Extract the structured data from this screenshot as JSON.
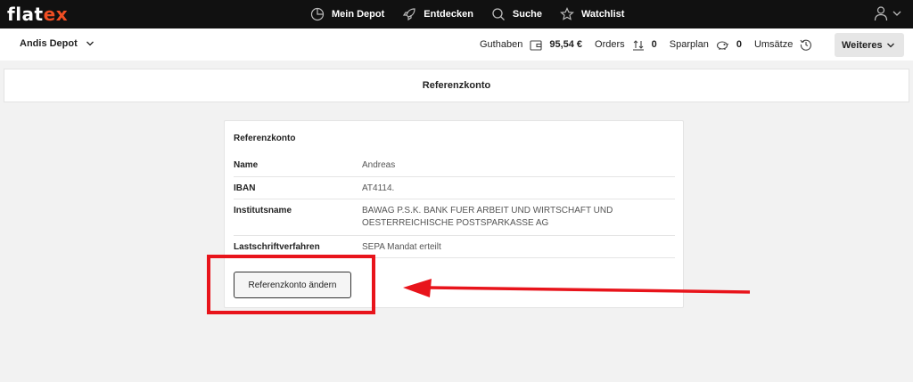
{
  "brand": {
    "logo_left": "flat",
    "logo_right": "ex",
    "accent": "#f04e23"
  },
  "topnav": [
    {
      "label": "Mein Depot",
      "icon": "pie-chart-icon"
    },
    {
      "label": "Entdecken",
      "icon": "rocket-icon"
    },
    {
      "label": "Suche",
      "icon": "search-icon"
    },
    {
      "label": "Watchlist",
      "icon": "star-icon"
    }
  ],
  "subbar": {
    "depot_name": "Andis Depot",
    "guthaben_label": "Guthaben",
    "guthaben_value": "95,54 €",
    "orders_label": "Orders",
    "orders_value": "0",
    "sparplan_label": "Sparplan",
    "sparplan_value": "0",
    "umsaetze_label": "Umsätze",
    "more_label": "Weiteres"
  },
  "page_title": "Referenzkonto",
  "card": {
    "title": "Referenzkonto",
    "rows": [
      {
        "key": "Name",
        "value": "Andreas"
      },
      {
        "key": "IBAN",
        "value": "AT4114."
      },
      {
        "key": "Institutsname",
        "value": "BAWAG P.S.K. BANK FUER ARBEIT UND WIRTSCHAFT UND OESTERREICHISCHE POSTSPARKASSE AG"
      },
      {
        "key": "Lastschriftverfahren",
        "value": "SEPA Mandat erteilt"
      }
    ],
    "change_button": "Referenzkonto ändern"
  },
  "annotation_color": "#e8141b"
}
